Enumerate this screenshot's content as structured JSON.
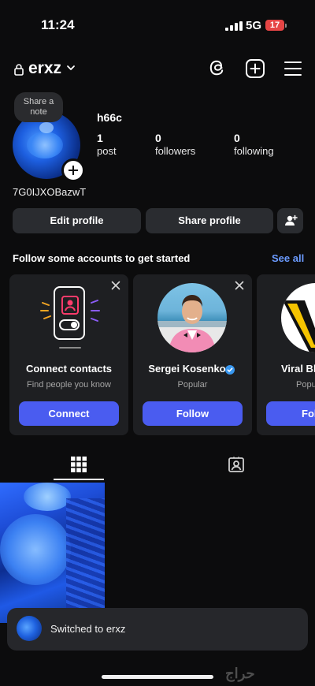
{
  "status_bar": {
    "time": "11:24",
    "network": "5G",
    "battery": "17"
  },
  "header": {
    "username": "erxz"
  },
  "profile": {
    "note_prompt": "Share a note",
    "display_name": "h66c",
    "handle": "7G0IJXOBazwT",
    "stats": [
      {
        "value": "1",
        "label": "post"
      },
      {
        "value": "0",
        "label": "followers"
      },
      {
        "value": "0",
        "label": "following"
      }
    ]
  },
  "actions": {
    "edit": "Edit profile",
    "share": "Share profile"
  },
  "suggestions": {
    "heading": "Follow some accounts to get started",
    "see_all": "See all",
    "cards": [
      {
        "title": "Connect contacts",
        "subtitle": "Find people you know",
        "button": "Connect"
      },
      {
        "title": "Sergei Kosenko",
        "subtitle": "Popular",
        "button": "Follow"
      },
      {
        "title": "Viral Bh",
        "subtitle": "Popu",
        "button": "Fol"
      }
    ]
  },
  "toast": {
    "text": "Switched to erxz"
  },
  "watermark": "حراج",
  "colors": {
    "accent": "#4a5cf0",
    "link": "#6b9bff",
    "background": "#0c0c0d",
    "card": "#1e1f22"
  }
}
